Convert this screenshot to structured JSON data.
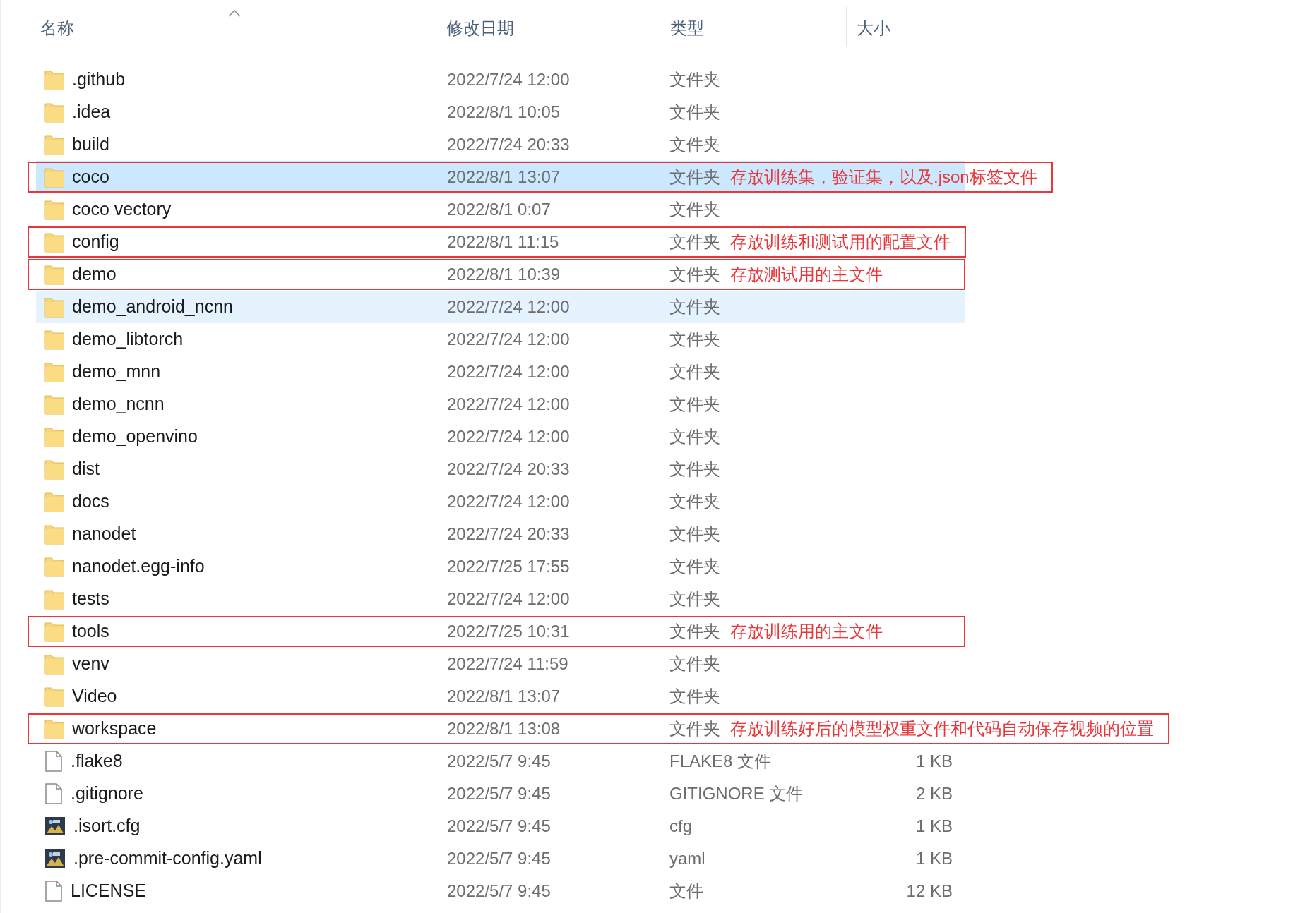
{
  "columns": [
    {
      "label": "名称",
      "sorted": true
    },
    {
      "label": "修改日期",
      "sorted": false
    },
    {
      "label": "类型",
      "sorted": false
    },
    {
      "label": "大小",
      "sorted": false
    }
  ],
  "rows": [
    {
      "kind": "folder",
      "name": ".github",
      "date": "2022/7/24 12:00",
      "type": "文件夹",
      "selected": false,
      "hovered": false
    },
    {
      "kind": "folder",
      "name": ".idea",
      "date": "2022/8/1 10:05",
      "type": "文件夹",
      "selected": false,
      "hovered": false
    },
    {
      "kind": "folder",
      "name": "build",
      "date": "2022/7/24 20:33",
      "type": "文件夹",
      "selected": false,
      "hovered": false
    },
    {
      "kind": "folder",
      "name": "coco",
      "date": "2022/8/1 13:07",
      "type": "文件夹",
      "selected": true,
      "hovered": false,
      "note": "存放训练集，验证集，以及.json标签文件"
    },
    {
      "kind": "folder",
      "name": "coco vectory",
      "date": "2022/8/1 0:07",
      "type": "文件夹",
      "selected": false,
      "hovered": false
    },
    {
      "kind": "folder",
      "name": "config",
      "date": "2022/8/1 11:15",
      "type": "文件夹",
      "selected": false,
      "hovered": false,
      "note": "存放训练和测试用的配置文件"
    },
    {
      "kind": "folder",
      "name": "demo",
      "date": "2022/8/1 10:39",
      "type": "文件夹",
      "selected": false,
      "hovered": false,
      "note": "存放测试用的主文件"
    },
    {
      "kind": "folder",
      "name": "demo_android_ncnn",
      "date": "2022/7/24 12:00",
      "type": "文件夹",
      "selected": false,
      "hovered": true
    },
    {
      "kind": "folder",
      "name": "demo_libtorch",
      "date": "2022/7/24 12:00",
      "type": "文件夹",
      "selected": false,
      "hovered": false
    },
    {
      "kind": "folder",
      "name": "demo_mnn",
      "date": "2022/7/24 12:00",
      "type": "文件夹",
      "selected": false,
      "hovered": false
    },
    {
      "kind": "folder",
      "name": "demo_ncnn",
      "date": "2022/7/24 12:00",
      "type": "文件夹",
      "selected": false,
      "hovered": false
    },
    {
      "kind": "folder",
      "name": "demo_openvino",
      "date": "2022/7/24 12:00",
      "type": "文件夹",
      "selected": false,
      "hovered": false
    },
    {
      "kind": "folder",
      "name": "dist",
      "date": "2022/7/24 20:33",
      "type": "文件夹",
      "selected": false,
      "hovered": false
    },
    {
      "kind": "folder",
      "name": "docs",
      "date": "2022/7/24 12:00",
      "type": "文件夹",
      "selected": false,
      "hovered": false
    },
    {
      "kind": "folder",
      "name": "nanodet",
      "date": "2022/7/24 20:33",
      "type": "文件夹",
      "selected": false,
      "hovered": false
    },
    {
      "kind": "folder",
      "name": "nanodet.egg-info",
      "date": "2022/7/25 17:55",
      "type": "文件夹",
      "selected": false,
      "hovered": false
    },
    {
      "kind": "folder",
      "name": "tests",
      "date": "2022/7/24 12:00",
      "type": "文件夹",
      "selected": false,
      "hovered": false
    },
    {
      "kind": "folder",
      "name": "tools",
      "date": "2022/7/25 10:31",
      "type": "文件夹",
      "selected": false,
      "hovered": false,
      "note": "存放训练用的主文件"
    },
    {
      "kind": "folder",
      "name": "venv",
      "date": "2022/7/24 11:59",
      "type": "文件夹",
      "selected": false,
      "hovered": false
    },
    {
      "kind": "folder",
      "name": "Video",
      "date": "2022/8/1 13:07",
      "type": "文件夹",
      "selected": false,
      "hovered": false
    },
    {
      "kind": "folder",
      "name": "workspace",
      "date": "2022/8/1 13:08",
      "type": "文件夹",
      "selected": false,
      "hovered": false,
      "note": "存放训练好后的模型权重文件和代码自动保存视频的位置"
    },
    {
      "kind": "file",
      "name": ".flake8",
      "date": "2022/5/7 9:45",
      "type": "FLAKE8 文件",
      "size": "1 KB",
      "selected": false,
      "hovered": false
    },
    {
      "kind": "file",
      "name": ".gitignore",
      "date": "2022/5/7 9:45",
      "type": "GITIGNORE 文件",
      "size": "2 KB",
      "selected": false,
      "hovered": false
    },
    {
      "kind": "app",
      "name": ".isort.cfg",
      "date": "2022/5/7 9:45",
      "type": "cfg",
      "size": "1 KB",
      "selected": false,
      "hovered": false
    },
    {
      "kind": "app",
      "name": ".pre-commit-config.yaml",
      "date": "2022/5/7 9:45",
      "type": "yaml",
      "size": "1 KB",
      "selected": false,
      "hovered": false
    },
    {
      "kind": "file",
      "name": "LICENSE",
      "date": "2022/5/7 9:45",
      "type": "文件",
      "size": "12 KB",
      "selected": false,
      "hovered": false
    }
  ]
}
